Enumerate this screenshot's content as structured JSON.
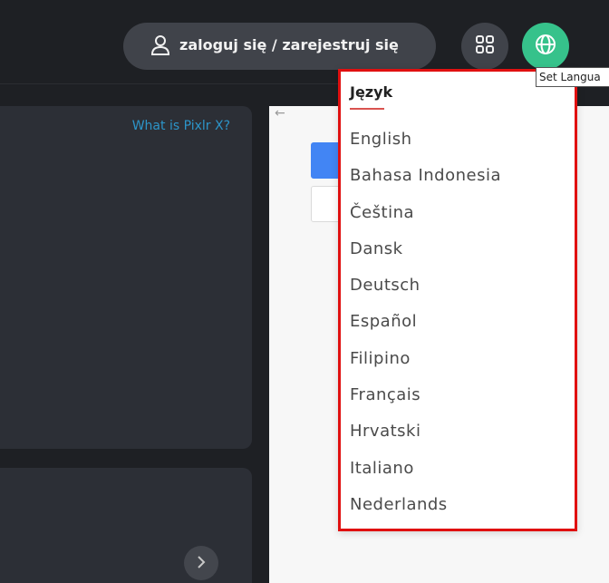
{
  "header": {
    "login_label": "zaloguj się / zarejestruj się",
    "tooltip": "Set Langua"
  },
  "panel1": {
    "link": "What is Pixlr X?"
  },
  "language_menu": {
    "heading": "Język",
    "items": [
      "English",
      "Bahasa Indonesia",
      "Čeština",
      "Dansk",
      "Deutsch",
      "Español",
      "Filipino",
      "Français",
      "Hrvatski",
      "Italiano",
      "Nederlands"
    ]
  },
  "icons": {
    "user": "user-icon",
    "apps": "apps-grid-icon",
    "globe": "globe-icon",
    "chevron": "chevron-right-icon",
    "back": "back-arrow-icon"
  },
  "colors": {
    "background": "#1e2024",
    "panel": "#2c2f36",
    "accent_green": "#36c28b",
    "link_blue": "#2c95c9",
    "highlight_red": "#e01010"
  }
}
